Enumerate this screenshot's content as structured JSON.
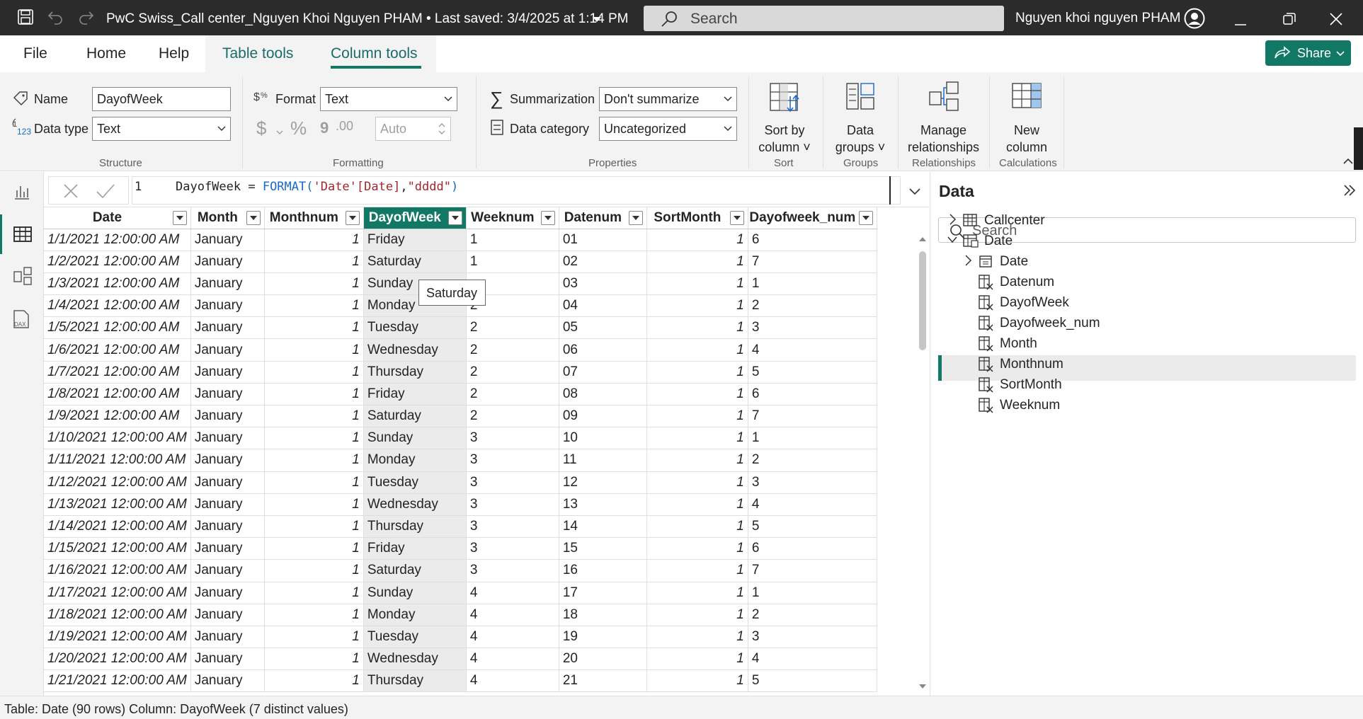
{
  "app": {
    "title": "PwC Swiss_Call center_Nguyen Khoi Nguyen PHAM • Last saved: 3/4/2025 at 1:14 PM",
    "search_placeholder": "Search",
    "user_name": "Nguyen khoi nguyen PHAM",
    "icons": [
      "save-icon",
      "undo-icon",
      "redo-icon",
      "dropdown-icon",
      "search-icon",
      "avatar-icon",
      "minimize-icon",
      "restore-icon",
      "close-icon"
    ]
  },
  "tabs": {
    "file": "File",
    "home": "Home",
    "help": "Help",
    "table_tools": "Table tools",
    "column_tools": "Column tools",
    "active": "Column tools",
    "share": "Share"
  },
  "ribbon": {
    "structure": {
      "name_label": "Name",
      "name_value": "DayofWeek",
      "datatype_label": "Data type",
      "datatype_value": "Text",
      "group_label": "Structure"
    },
    "formatting": {
      "format_label": "Format",
      "format_value": "Text",
      "currency_symbol": "$",
      "percent_symbol": "%",
      "comma_symbol": "9",
      "decimal_symbol": ".00",
      "auto_value": "Auto",
      "group_label": "Formatting"
    },
    "properties": {
      "summarization_label": "Summarization",
      "summarization_value": "Don't summarize",
      "category_label": "Data category",
      "category_value": "Uncategorized",
      "group_label": "Properties"
    },
    "sort": {
      "button_line1": "Sort by",
      "button_line2": "column",
      "group_label": "Sort"
    },
    "groups": {
      "button_line1": "Data",
      "button_line2": "groups",
      "group_label": "Groups"
    },
    "relationships": {
      "button_line1": "Manage",
      "button_line2": "relationships",
      "group_label": "Relationships"
    },
    "calculations": {
      "button_line1": "New",
      "button_line2": "column",
      "group_label": "Calculations"
    }
  },
  "formula": {
    "line_number": "1",
    "text_a": "DayofWeek = ",
    "text_fn": "FORMAT(",
    "text_col": "'Date'[Date]",
    "text_comma": ",",
    "text_str": "\"dddd\"",
    "text_close": ")"
  },
  "table": {
    "columns": [
      "Date",
      "Month",
      "Monthnum",
      "DayofWeek",
      "Weeknum",
      "Datenum",
      "SortMonth",
      "Dayofweek_num"
    ],
    "selected_column": "DayofWeek",
    "rows": [
      [
        "1/1/2021 12:00:00 AM",
        "January",
        "1",
        "Friday",
        "1",
        "01",
        "1",
        "6"
      ],
      [
        "1/2/2021 12:00:00 AM",
        "January",
        "1",
        "Saturday",
        "1",
        "02",
        "1",
        "7"
      ],
      [
        "1/3/2021 12:00:00 AM",
        "January",
        "1",
        "Sunday",
        "",
        "03",
        "1",
        "1"
      ],
      [
        "1/4/2021 12:00:00 AM",
        "January",
        "1",
        "Monday",
        "2",
        "04",
        "1",
        "2"
      ],
      [
        "1/5/2021 12:00:00 AM",
        "January",
        "1",
        "Tuesday",
        "2",
        "05",
        "1",
        "3"
      ],
      [
        "1/6/2021 12:00:00 AM",
        "January",
        "1",
        "Wednesday",
        "2",
        "06",
        "1",
        "4"
      ],
      [
        "1/7/2021 12:00:00 AM",
        "January",
        "1",
        "Thursday",
        "2",
        "07",
        "1",
        "5"
      ],
      [
        "1/8/2021 12:00:00 AM",
        "January",
        "1",
        "Friday",
        "2",
        "08",
        "1",
        "6"
      ],
      [
        "1/9/2021 12:00:00 AM",
        "January",
        "1",
        "Saturday",
        "2",
        "09",
        "1",
        "7"
      ],
      [
        "1/10/2021 12:00:00 AM",
        "January",
        "1",
        "Sunday",
        "3",
        "10",
        "1",
        "1"
      ],
      [
        "1/11/2021 12:00:00 AM",
        "January",
        "1",
        "Monday",
        "3",
        "11",
        "1",
        "2"
      ],
      [
        "1/12/2021 12:00:00 AM",
        "January",
        "1",
        "Tuesday",
        "3",
        "12",
        "1",
        "3"
      ],
      [
        "1/13/2021 12:00:00 AM",
        "January",
        "1",
        "Wednesday",
        "3",
        "13",
        "1",
        "4"
      ],
      [
        "1/14/2021 12:00:00 AM",
        "January",
        "1",
        "Thursday",
        "3",
        "14",
        "1",
        "5"
      ],
      [
        "1/15/2021 12:00:00 AM",
        "January",
        "1",
        "Friday",
        "3",
        "15",
        "1",
        "6"
      ],
      [
        "1/16/2021 12:00:00 AM",
        "January",
        "1",
        "Saturday",
        "3",
        "16",
        "1",
        "7"
      ],
      [
        "1/17/2021 12:00:00 AM",
        "January",
        "1",
        "Sunday",
        "4",
        "17",
        "1",
        "1"
      ],
      [
        "1/18/2021 12:00:00 AM",
        "January",
        "1",
        "Monday",
        "4",
        "18",
        "1",
        "2"
      ],
      [
        "1/19/2021 12:00:00 AM",
        "January",
        "1",
        "Tuesday",
        "4",
        "19",
        "1",
        "3"
      ],
      [
        "1/20/2021 12:00:00 AM",
        "January",
        "1",
        "Wednesday",
        "4",
        "20",
        "1",
        "4"
      ],
      [
        "1/21/2021 12:00:00 AM",
        "January",
        "1",
        "Thursday",
        "4",
        "21",
        "1",
        "5"
      ]
    ],
    "tooltip": "Saturday"
  },
  "data_pane": {
    "title": "Data",
    "search_placeholder": "Search",
    "tables": [
      {
        "name": "Callcenter",
        "expanded": false
      },
      {
        "name": "Date",
        "expanded": true
      }
    ],
    "date_fields": [
      "Date",
      "Datenum",
      "DayofWeek",
      "Dayofweek_num",
      "Month",
      "Monthnum",
      "SortMonth",
      "Weeknum"
    ],
    "selected_field": "DayofWeek"
  },
  "status": {
    "text": "Table: Date (90 rows) Column: DayofWeek (7 distinct values)"
  },
  "colors": {
    "accent": "#117865",
    "titlebar": "#2b2b2b",
    "ribbon_bg": "#f3f3f3",
    "dax_function": "#1b6ac9",
    "dax_string": "#a4262c"
  }
}
